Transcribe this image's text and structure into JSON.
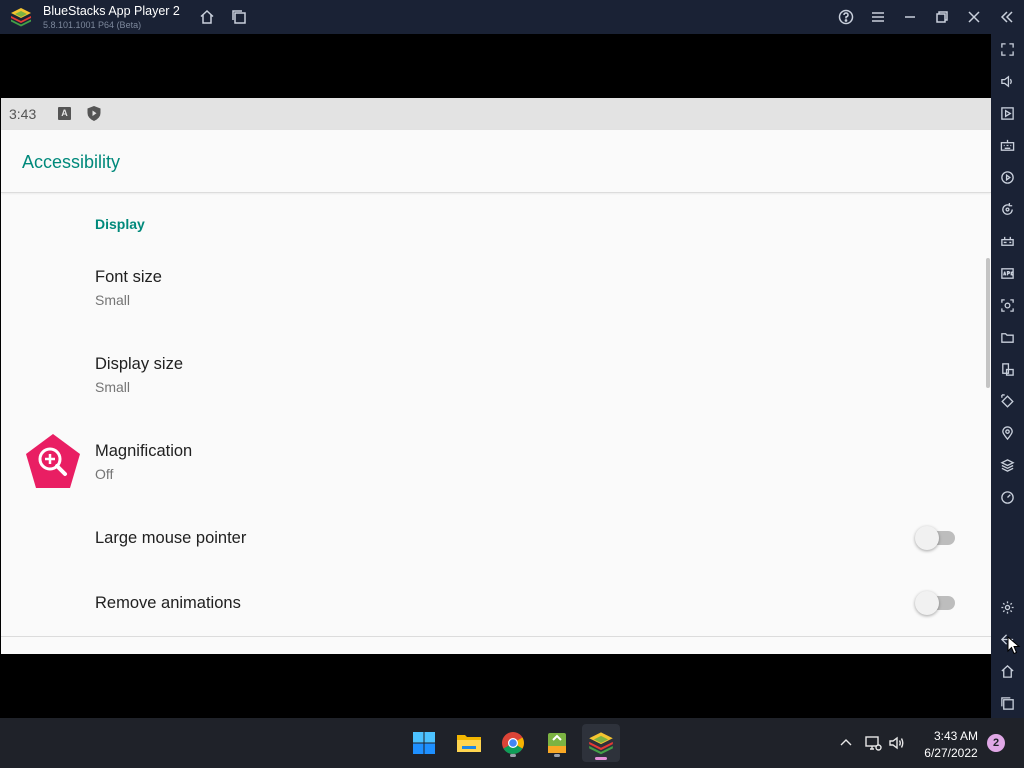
{
  "window": {
    "title": "BlueStacks App Player 2",
    "version": "5.8.101.1001 P64 (Beta)",
    "buttons": [
      "home-icon",
      "multi-instance-icon",
      "help-icon",
      "menu-icon",
      "minimize-icon",
      "restore-icon",
      "close-icon",
      "collapse-sidebar-icon"
    ]
  },
  "sidebar": {
    "items": [
      "fullscreen-icon",
      "volume-icon",
      "media-manager-icon",
      "keyboard-controls-icon",
      "macro-recorder-icon",
      "sync-icon",
      "gamepad-icon",
      "install-apk-icon",
      "screenshot-icon",
      "folder-icon",
      "multi-instance-manager-icon",
      "rotate-icon",
      "location-icon",
      "layers-icon",
      "eco-mode-icon",
      "settings-icon",
      "back-icon",
      "android-home-icon",
      "recent-apps-icon"
    ]
  },
  "android": {
    "status": {
      "time": "3:43",
      "icon_a": "A"
    },
    "appbar": {
      "title": "Accessibility"
    },
    "section": "Display",
    "prefs": [
      {
        "title": "Font size",
        "summary": "Small"
      },
      {
        "title": "Display size",
        "summary": "Small"
      },
      {
        "title": "Magnification",
        "summary": "Off"
      },
      {
        "title": "Large mouse pointer",
        "toggle": false
      },
      {
        "title": "Remove animations",
        "toggle": false
      }
    ],
    "accent_color": "#00897b",
    "magnification_icon_color": "#e91e63"
  },
  "taskbar": {
    "apps": [
      "windows-start-icon",
      "file-explorer-icon",
      "chrome-icon",
      "bluestacks-x-icon",
      "bluestacks-player-icon"
    ],
    "clock": {
      "time": "3:43 AM",
      "date": "6/27/2022"
    },
    "notifications": "2"
  }
}
